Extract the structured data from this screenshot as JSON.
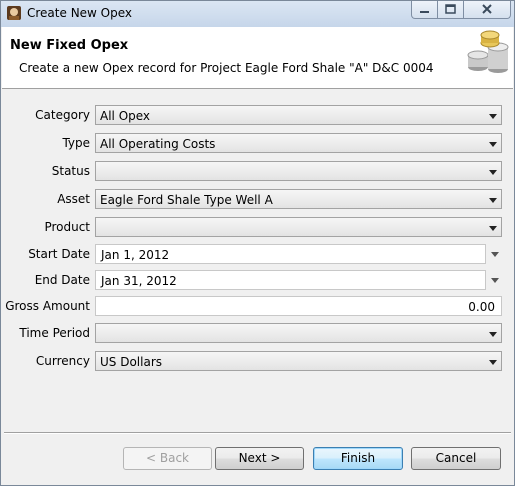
{
  "window": {
    "title": "Create New Opex"
  },
  "header": {
    "title": "New Fixed Opex",
    "subtitle": "Create a new Opex record for Project Eagle Ford Shale \"A\" D&C 0004"
  },
  "form": {
    "category": {
      "label": "Category",
      "value": "All Opex"
    },
    "type": {
      "label": "Type",
      "value": "All Operating Costs"
    },
    "status": {
      "label": "Status",
      "value": ""
    },
    "asset": {
      "label": "Asset",
      "value": "Eagle Ford Shale Type Well A"
    },
    "product": {
      "label": "Product",
      "value": ""
    },
    "start_date": {
      "label": "Start Date",
      "value": "Jan 1, 2012"
    },
    "end_date": {
      "label": "End Date",
      "value": "Jan 31, 2012"
    },
    "gross_amount": {
      "label": "Gross Amount",
      "value": "0.00"
    },
    "time_period": {
      "label": "Time Period",
      "value": ""
    },
    "currency": {
      "label": "Currency",
      "value": "US Dollars"
    }
  },
  "buttons": {
    "back": "< Back",
    "next": "Next >",
    "finish": "Finish",
    "cancel": "Cancel"
  },
  "icons": {
    "app": "app-icon",
    "header": "coins-icon"
  }
}
